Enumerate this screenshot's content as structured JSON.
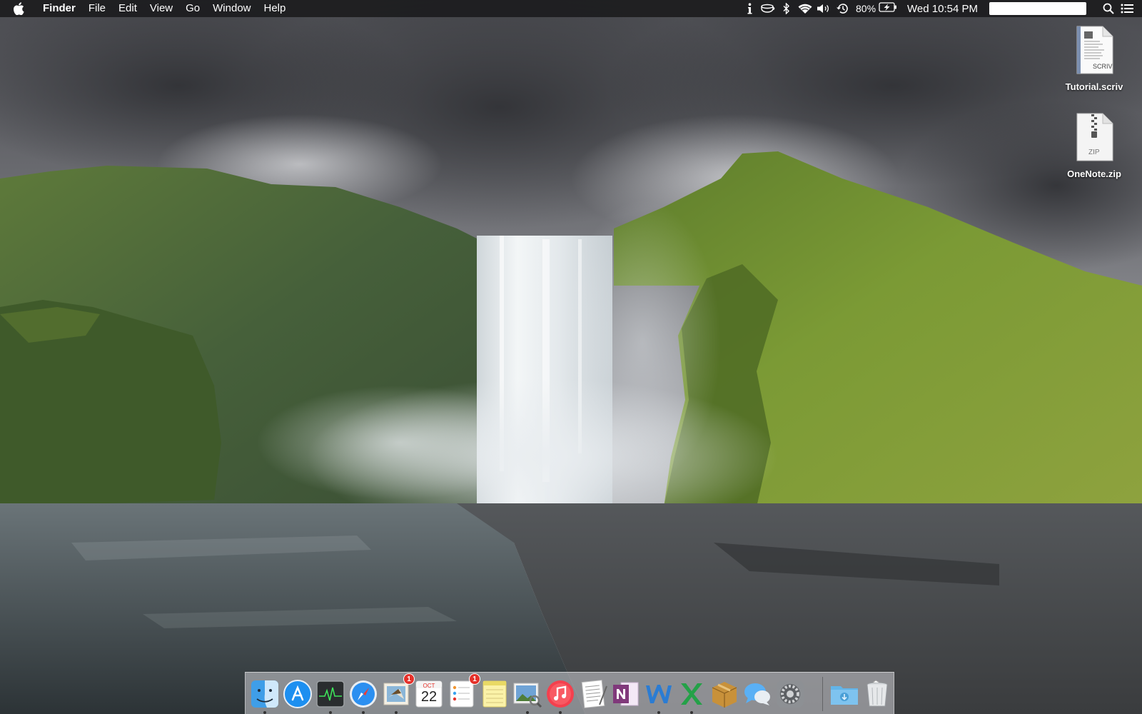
{
  "menubar": {
    "apple_icon": "apple-logo-icon",
    "app_name": "Finder",
    "menus": [
      "File",
      "Edit",
      "View",
      "Go",
      "Window",
      "Help"
    ],
    "status_icons": [
      "info-icon",
      "coffee-cup-icon",
      "bluetooth-icon",
      "wifi-icon",
      "volume-icon",
      "time-machine-icon"
    ],
    "battery_percent": "80%",
    "battery_state": "charging",
    "clock": "Wed 10:54 PM",
    "spotlight_icon": "search-icon",
    "notification_icon": "notification-center-icon"
  },
  "desktop_icons": [
    {
      "label": "Tutorial.scriv",
      "type_tag": "SCRIV",
      "icon": "scrivener-document-icon"
    },
    {
      "label": "OneNote.zip",
      "type_tag": "ZIP",
      "icon": "zip-archive-icon"
    }
  ],
  "dock": {
    "apps": [
      {
        "name": "Finder",
        "icon": "finder-icon",
        "running": true
      },
      {
        "name": "App Store",
        "icon": "app-store-icon",
        "running": false
      },
      {
        "name": "Activity Monitor",
        "icon": "activity-monitor-icon",
        "running": true
      },
      {
        "name": "Safari",
        "icon": "safari-icon",
        "running": true
      },
      {
        "name": "Mail",
        "icon": "mail-icon",
        "running": true,
        "badge": "1"
      },
      {
        "name": "Calendar",
        "icon": "calendar-icon",
        "running": false,
        "month": "OCT",
        "day": "22"
      },
      {
        "name": "Reminders",
        "icon": "reminders-icon",
        "running": false,
        "badge": "1"
      },
      {
        "name": "Notes",
        "icon": "notes-icon",
        "running": false
      },
      {
        "name": "Preview",
        "icon": "preview-icon",
        "running": true
      },
      {
        "name": "iTunes",
        "icon": "itunes-icon",
        "running": true
      },
      {
        "name": "TextEdit",
        "icon": "textedit-icon",
        "running": false
      },
      {
        "name": "OneNote",
        "icon": "onenote-icon",
        "running": false
      },
      {
        "name": "Word",
        "icon": "word-icon",
        "running": true
      },
      {
        "name": "Excel",
        "icon": "excel-icon",
        "running": true
      },
      {
        "name": "Archive Utility",
        "icon": "archive-utility-icon",
        "running": false
      },
      {
        "name": "Messages",
        "icon": "messages-icon",
        "running": false
      },
      {
        "name": "System Preferences",
        "icon": "system-preferences-icon",
        "running": false
      }
    ],
    "stacks": [
      {
        "name": "Downloads",
        "icon": "downloads-folder-icon"
      },
      {
        "name": "Trash",
        "icon": "trash-icon"
      }
    ]
  },
  "colors": {
    "menubar_bg": "#1c1c1e",
    "badge_red": "#e5312a",
    "grass_green": "#6f8f2f",
    "sky_gray": "#6e6f74"
  }
}
